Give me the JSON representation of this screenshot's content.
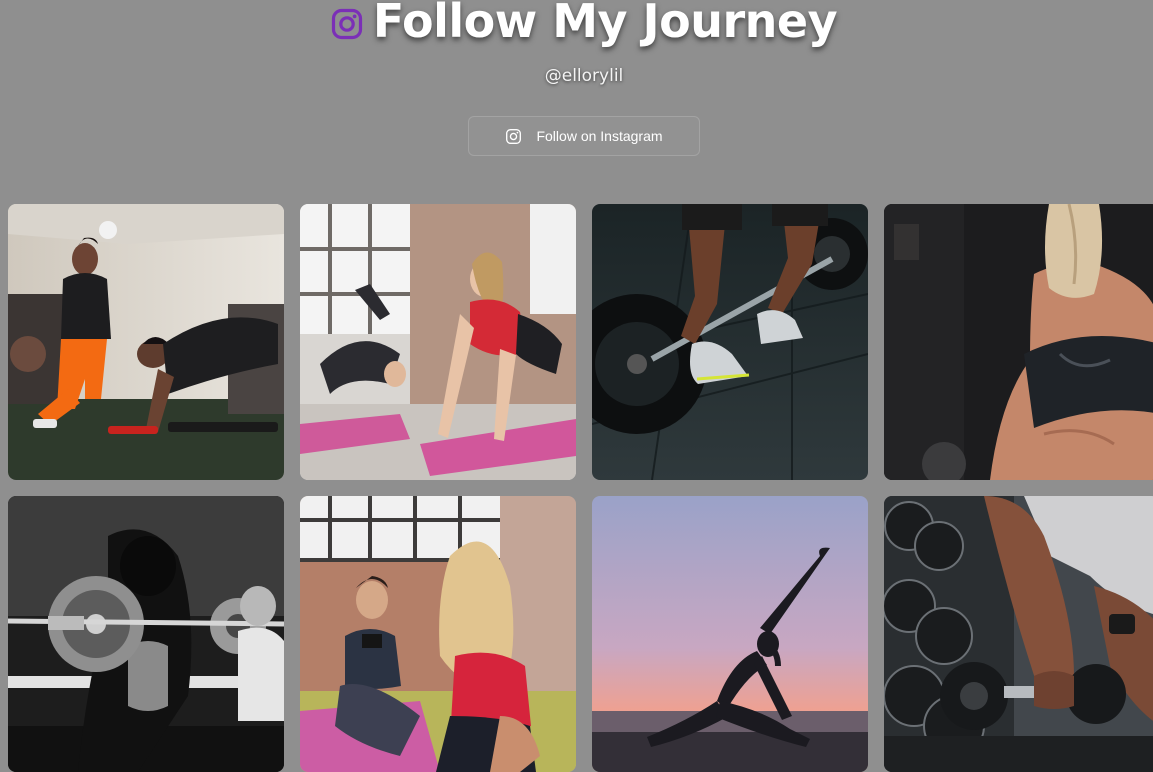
{
  "header": {
    "icon": "instagram-icon",
    "title": "Follow My Journey",
    "handle": "@ellorylil",
    "accent_color": "#7b2fb7"
  },
  "follow_button": {
    "label": "Follow on Instagram",
    "icon": "instagram-icon"
  },
  "gallery": {
    "photos": [
      {
        "subject": "trainer-with-client-pushup"
      },
      {
        "subject": "women-yoga-mat-exercise"
      },
      {
        "subject": "barbell-deadlift-gym-floor"
      },
      {
        "subject": "woman-back-sports-bra"
      },
      {
        "subject": "black-white-barbell-squat"
      },
      {
        "subject": "two-women-chatting-on-mat"
      },
      {
        "subject": "yoga-pose-sunset-silhouette"
      },
      {
        "subject": "man-lifting-dumbbells-rack"
      }
    ]
  }
}
